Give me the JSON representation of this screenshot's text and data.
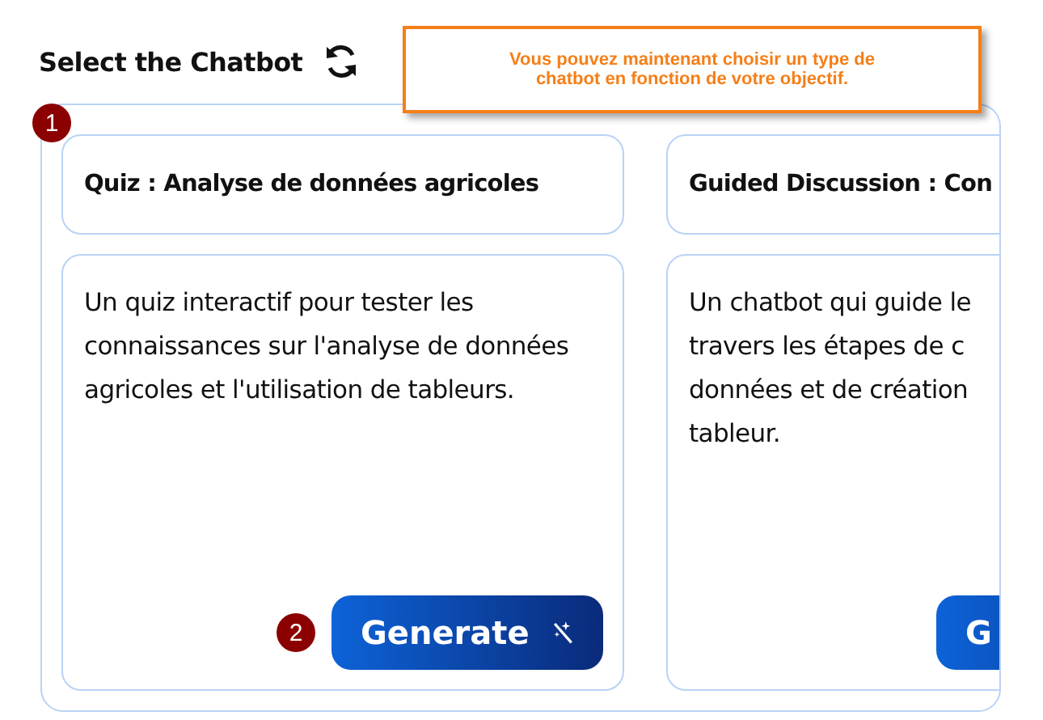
{
  "heading": "Select the Chatbot",
  "tooltip": "Vous pouvez maintenant choisir un type de chatbot en fonction de votre objectif.",
  "markers": [
    "1",
    "2"
  ],
  "chatbots": [
    {
      "title": "Quiz : Analyse de données agricoles",
      "description": "Un quiz interactif pour tester les connaissances sur l'analyse de données agricoles et l'utilisation de tableurs.",
      "button": "Generate"
    },
    {
      "title": "Guided Discussion : Con",
      "description_lines": [
        "Un chatbot qui guide le",
        "travers les étapes de c",
        "données et de création",
        "tableur."
      ],
      "button": "G"
    }
  ]
}
